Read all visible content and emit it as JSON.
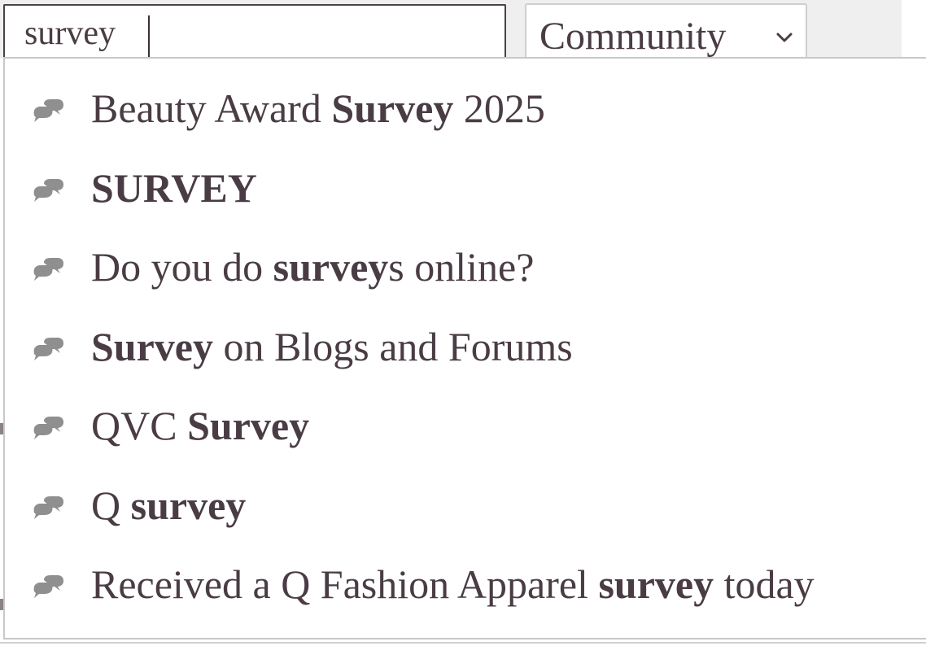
{
  "search": {
    "value": "survey",
    "placeholder": ""
  },
  "scope": {
    "selected": "Community"
  },
  "icons": {
    "suggestion": "chat-bubbles-icon",
    "dropdown_toggle": "chevron-down-icon"
  },
  "colors": {
    "text": "#4a3c44",
    "icon": "#8f8f8f",
    "border": "#c8c8c8",
    "strip": "#efefef"
  },
  "suggestions": [
    {
      "parts": [
        {
          "text": "Beauty Award ",
          "bold": false
        },
        {
          "text": "Survey",
          "bold": true
        },
        {
          "text": " 2025",
          "bold": false
        }
      ]
    },
    {
      "parts": [
        {
          "text": "SURVEY",
          "bold": true
        }
      ]
    },
    {
      "parts": [
        {
          "text": "Do you do ",
          "bold": false
        },
        {
          "text": "survey",
          "bold": true
        },
        {
          "text": "s online?",
          "bold": false
        }
      ]
    },
    {
      "parts": [
        {
          "text": "Survey",
          "bold": true
        },
        {
          "text": " on Blogs and Forums",
          "bold": false
        }
      ]
    },
    {
      "parts": [
        {
          "text": "QVC ",
          "bold": false
        },
        {
          "text": "Survey",
          "bold": true
        }
      ]
    },
    {
      "parts": [
        {
          "text": "Q ",
          "bold": false
        },
        {
          "text": "survey",
          "bold": true
        }
      ]
    },
    {
      "parts": [
        {
          "text": "Received a Q Fashion Apparel ",
          "bold": false
        },
        {
          "text": "survey",
          "bold": true
        },
        {
          "text": " today",
          "bold": false
        }
      ]
    }
  ]
}
